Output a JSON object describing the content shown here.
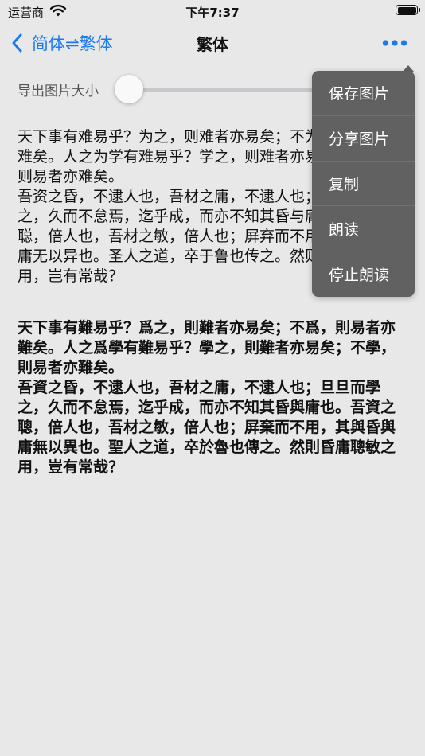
{
  "status_bar": {
    "carrier": "运营商",
    "time": "下午7:37"
  },
  "nav": {
    "back_label": "简体⇌繁体",
    "title": "繁体"
  },
  "slider": {
    "label": "导出图片大小",
    "value": 0
  },
  "content": {
    "simplified": "天下事有难易乎？为之，则难者亦易矣；不为，则易者亦难矣。人之为学有难易乎？学之，则难者亦易矣；不学，则易者亦难矣。\n吾资之昏，不逮人也，吾材之庸，不逮人也；旦旦而学之，久而不怠焉，迄乎成，而亦不知其昏与庸也。吾资之聪，倍人也，吾材之敏，倍人也；屏弃而不用，其与昏与庸无以异也。圣人之道，卒于鲁也传之。然则昏庸聪敏之用，岂有常哉？",
    "traditional": "天下事有難易乎？爲之，則難者亦易矣；不爲，則易者亦難矣。人之爲學有難易乎？學之，則難者亦易矣；不學，則易者亦難矣。\n吾資之昏，不逮人也，吾材之庸，不逮人也；旦旦而學之，久而不怠焉，迄乎成，而亦不知其昏與庸也。吾資之聰，倍人也，吾材之敏，倍人也；屏棄而不用，其與昏與庸無以異也。聖人之道，卒於魯也傳之。然則昏庸聰敏之用，豈有常哉？"
  },
  "menu": {
    "items": [
      {
        "label": "保存图片"
      },
      {
        "label": "分享图片"
      },
      {
        "label": "复制"
      },
      {
        "label": "朗读"
      },
      {
        "label": "停止朗读"
      }
    ]
  },
  "colors": {
    "accent": "#1a7aef",
    "background": "#e8e8e8",
    "menu_background": "#616161"
  },
  "icons": {
    "wifi": "wifi-icon",
    "battery": "battery-icon",
    "back": "chevron-left-icon",
    "more": "more-horizontal-icon"
  }
}
